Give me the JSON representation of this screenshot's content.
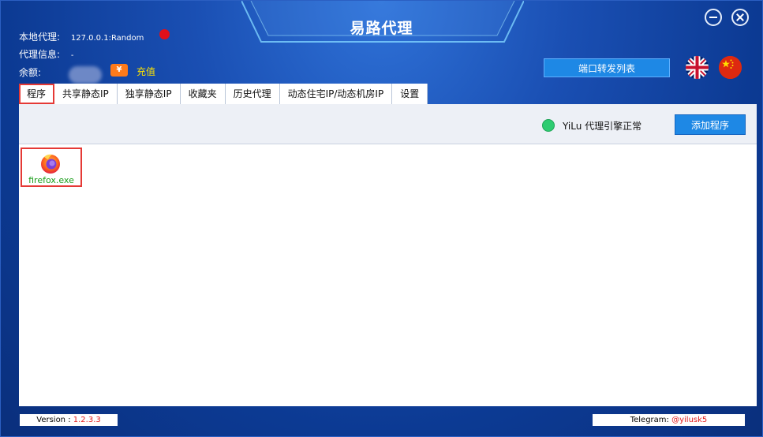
{
  "window": {
    "title": "易路代理"
  },
  "info": {
    "local_proxy_label": "本地代理:",
    "local_proxy_value": "127.0.0.1:Random",
    "proxy_info_label": "代理信息:",
    "proxy_info_value": "-",
    "balance_label": "余额:",
    "recharge_label": "充值",
    "recharge_icon_text": "¥",
    "status_color": "#e0101a"
  },
  "header": {
    "port_forward_label": "端口转发列表",
    "flags": [
      "uk-flag-icon",
      "china-flag-icon"
    ]
  },
  "tabs": [
    {
      "label": "程序",
      "active": true
    },
    {
      "label": "共享静态IP",
      "active": false
    },
    {
      "label": "独享静态IP",
      "active": false
    },
    {
      "label": "收藏夹",
      "active": false
    },
    {
      "label": "历史代理",
      "active": false
    },
    {
      "label": "动态住宅IP/动态机房IP",
      "active": false
    },
    {
      "label": "设置",
      "active": false
    }
  ],
  "toolbar": {
    "engine_status": "YiLu 代理引擎正常",
    "engine_status_color": "#2ecc71",
    "add_program_label": "添加程序"
  },
  "programs": [
    {
      "name": "firefox.exe",
      "icon": "firefox-icon"
    }
  ],
  "footer": {
    "version_label": "Version : ",
    "version_value": "1.2.3.3",
    "telegram_label": "Telegram: ",
    "telegram_value": "@yilusk5"
  },
  "colors": {
    "accent": "#1e88e5",
    "highlight": "#e53935",
    "recharge": "#ffe400"
  }
}
